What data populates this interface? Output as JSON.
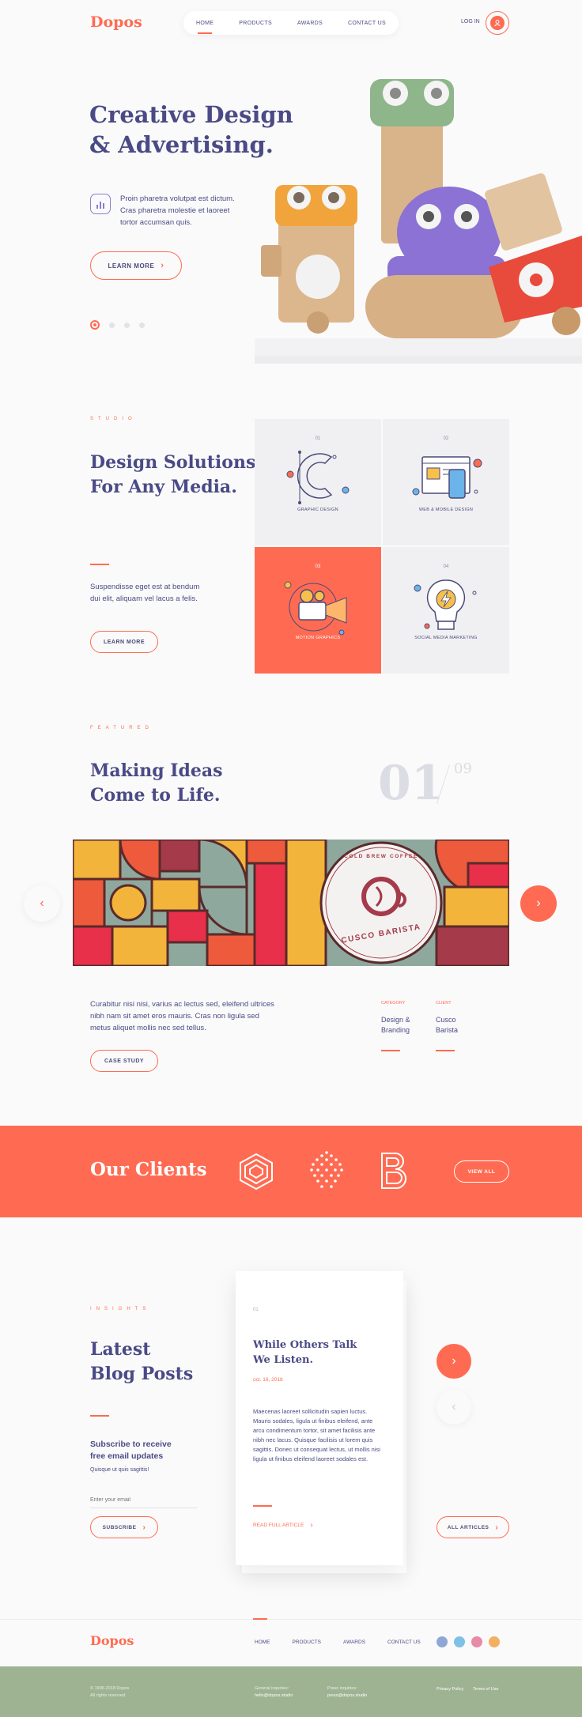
{
  "header": {
    "logo": "Dopos",
    "nav": [
      "HOME",
      "PRODUCTS",
      "AWARDS",
      "CONTACT US"
    ],
    "login": "LOG IN"
  },
  "hero": {
    "title_line1": "Creative Design",
    "title_line2": "& Advertising.",
    "description": "Proin pharetra volutpat est dictum. Cras pharetra molestie et laoreet tortor accumsan quis.",
    "cta": "LEARN MORE"
  },
  "studio": {
    "eyebrow": "STUDIO",
    "title_line1": "Design Solutions",
    "title_line2": "For Any Media.",
    "description": "Suspendisse eget est at bendum dui elit, aliquam vel lacus a felis.",
    "cta": "LEARN MORE",
    "services": [
      {
        "num": "01",
        "label": "GRAPHIC DESIGN"
      },
      {
        "num": "02",
        "label": "WEB & MOBILE DESIGN"
      },
      {
        "num": "03",
        "label": "MOTION GRAPHICS"
      },
      {
        "num": "04",
        "label": "SOCIAL MEDIA MARKETING"
      }
    ]
  },
  "featured": {
    "eyebrow": "FEATURED",
    "title_line1": "Making Ideas",
    "title_line2": "Come to Life.",
    "counter_current": "01",
    "counter_total": "09",
    "badge_arc": "COLD BREW COFFEE",
    "badge_brand": "CUSCO BARISTA",
    "description": "Curabitur nisi nisi, varius ac lectus sed, eleifend ultrices nibh nam sit amet eros mauris. Cras non ligula sed metus aliquet mollis nec sed tellus.",
    "cta": "CASE STUDY",
    "category_label": "CATEGORY",
    "category_value_1": "Design &",
    "category_value_2": "Branding",
    "client_label": "CLIENT",
    "client_value_1": "Cusco",
    "client_value_2": "Barista"
  },
  "clients": {
    "title": "Our Clients",
    "cta": "VIEW ALL"
  },
  "insights": {
    "eyebrow": "INSIGHTS",
    "title_line1": "Latest",
    "title_line2": "Blog Posts",
    "subscribe_line1": "Subscribe to receive",
    "subscribe_line2": "free email updates",
    "subscribe_sub": "Quisque ut quis sagittis!",
    "email_placeholder": "Enter your email",
    "subscribe_cta": "SUBSCRIBE",
    "post_num": "01",
    "post_title_line1": "While Others Talk",
    "post_title_line2": "We Listen.",
    "post_date": "oct. 16, 2018",
    "post_body": "Maecenas laoreet sollicitudin sapien luctus. Mauris sodales, ligula ut finibus eleifend, ante arcu condimentum tortor, sit amet facilisis ante nibh nec lacus. Quisque facilisis ut lorem quis sagittis. Donec ut consequat lectus, ut mollis nisi ligula ut finibus eleifend laoreet sodales est.",
    "read_more": "READ FULL ARTICLE",
    "all_articles": "ALL ARTICLES"
  },
  "footer": {
    "logo": "Dopos",
    "nav": [
      "HOME",
      "PRODUCTS",
      "AWARDS",
      "CONTACT US"
    ],
    "copyright_1": "© 1996-2018 Dopos",
    "copyright_2": "All rights reserved.",
    "general_label": "General inquiries:",
    "general_email": "hello@dopos.studio",
    "press_label": "Press inquiries:",
    "press_email": "press@dopos.studio",
    "privacy": "Privacy Policy",
    "terms": "Terms of Use"
  },
  "colors": {
    "accent": "#ff6b52",
    "navy": "#4a4a86",
    "footer_band": "#9eb392",
    "tile": "#f0f0f2"
  }
}
